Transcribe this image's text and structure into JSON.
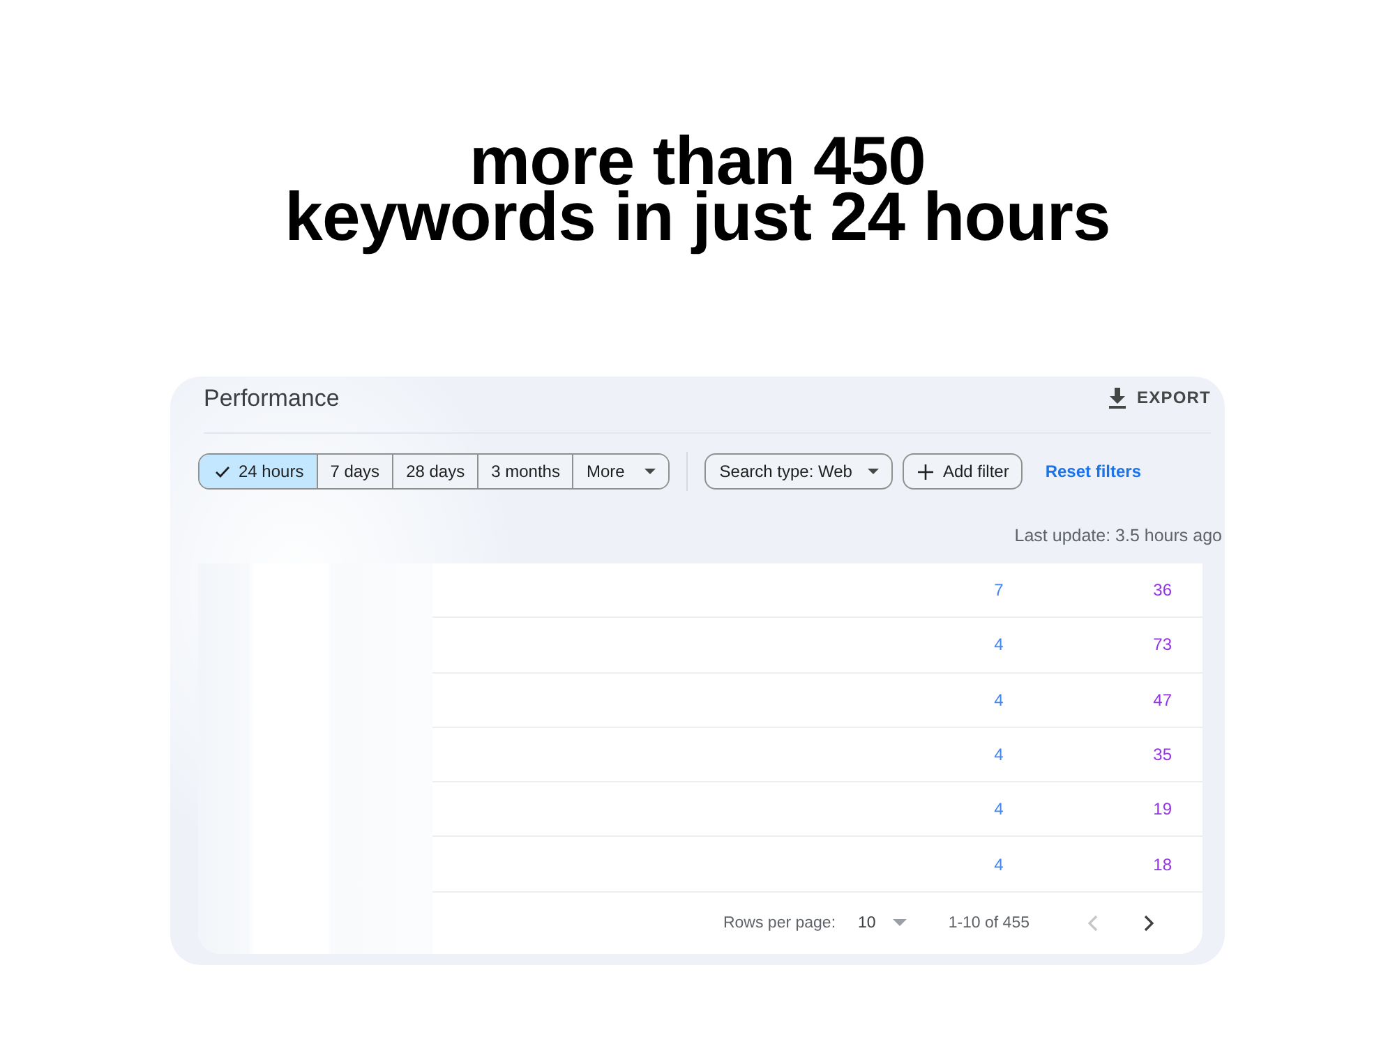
{
  "headline": {
    "lines": [
      "more than 450",
      "keywords in just 24 hours"
    ]
  },
  "panel": {
    "title": "Performance",
    "export_label": "EXPORT",
    "date_ranges": [
      {
        "kind": "option",
        "label": "24 hours",
        "selected": true
      },
      {
        "kind": "option",
        "label": "7 days",
        "selected": false
      },
      {
        "kind": "option",
        "label": "28 days",
        "selected": false
      },
      {
        "kind": "option",
        "label": "3 months",
        "selected": false
      },
      {
        "kind": "menu",
        "label": "More",
        "selected": false
      }
    ],
    "filters": [
      {
        "kind": "dropdown",
        "label": "Search type: Web"
      },
      {
        "kind": "add",
        "label": "Add filter"
      }
    ],
    "reset_label": "Reset filters",
    "last_update": "Last update: 3.5 hours ago",
    "table": {
      "rows": [
        {
          "column_2": "7",
          "column_3": "36"
        },
        {
          "column_2": "4",
          "column_3": "73"
        },
        {
          "column_2": "4",
          "column_3": "47"
        },
        {
          "column_2": "4",
          "column_3": "35"
        },
        {
          "column_2": "4",
          "column_3": "19"
        },
        {
          "column_2": "4",
          "column_3": "18"
        }
      ]
    },
    "pagination": {
      "rows_per_page_label": "Rows per page:",
      "rows_per_page": "10",
      "range": "1-10 of 455",
      "prev_disabled": true,
      "next_disabled": false
    }
  }
}
